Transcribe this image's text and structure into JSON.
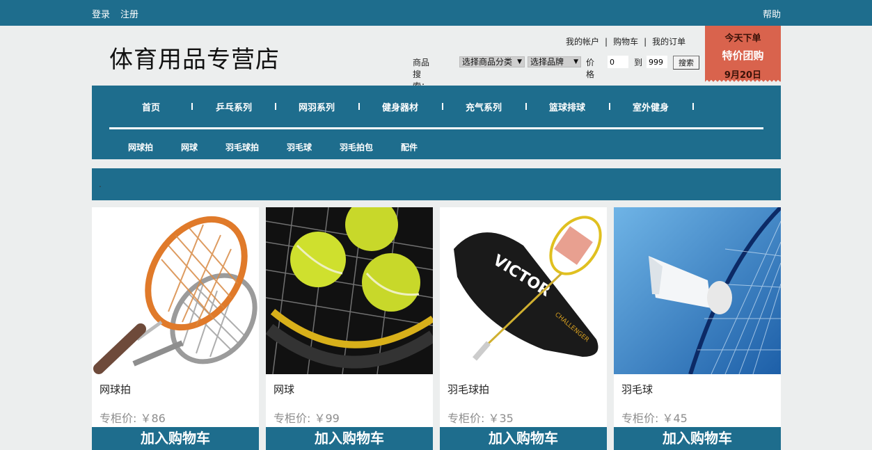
{
  "topbar": {
    "login": "登录",
    "register": "注册",
    "help": "帮助"
  },
  "logo": "体育用品专营店",
  "account": {
    "my_account": "我的帐户",
    "sep": "|",
    "cart": "购物车",
    "orders": "我的订单"
  },
  "search": {
    "label": "商品搜索：",
    "category": "选择商品分类",
    "brand": "选择品牌",
    "price_label": "价格",
    "min": "0",
    "to": "到",
    "max": "999",
    "button": "搜索"
  },
  "promo": {
    "line1": "今天下单",
    "line2": "特价团购",
    "date": "9月20日"
  },
  "nav": {
    "main": [
      "首页",
      "乒乓系列",
      "网羽系列",
      "健身器材",
      "充气系列",
      "篮球排球",
      "室外健身"
    ],
    "sub": [
      "网球拍",
      "网球",
      "羽毛球拍",
      "羽毛球",
      "羽毛拍包",
      "配件"
    ]
  },
  "banner": {
    "text": "."
  },
  "products": [
    {
      "name": "网球拍",
      "price": "专柜价: ￥86",
      "button": "加入购物车"
    },
    {
      "name": "网球",
      "price": "专柜价: ￥99",
      "button": "加入购物车"
    },
    {
      "name": "羽毛球拍",
      "price": "专柜价: ￥35",
      "button": "加入购物车"
    },
    {
      "name": "羽毛球",
      "price": "专柜价: ￥45",
      "button": "加入购物车"
    }
  ],
  "image_text": {
    "victor": "VICTOR",
    "challenger": "CHALLENGER"
  },
  "colors": {
    "primary": "#1e6d8d",
    "promo": "#d9634d",
    "background": "#eceeee"
  }
}
